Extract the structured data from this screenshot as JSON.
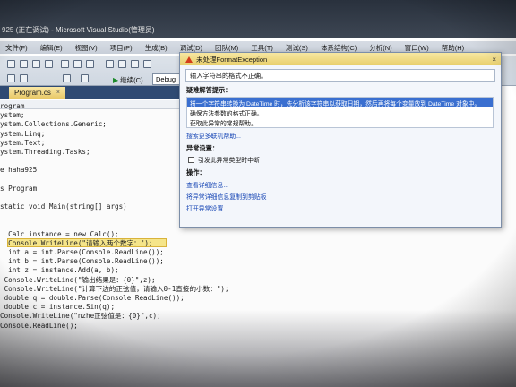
{
  "window": {
    "title": "925 (正在调试) - Microsoft Visual Studio(管理员)"
  },
  "menu": [
    "文件(F)",
    "编辑(E)",
    "视图(V)",
    "项目(P)",
    "生成(B)",
    "调试(D)",
    "团队(M)",
    "工具(T)",
    "测试(S)",
    "体系结构(C)",
    "分析(N)",
    "窗口(W)",
    "帮助(H)"
  ],
  "toolbar": {
    "continue_label": "继续(C)",
    "config_value": "Debug"
  },
  "tab": {
    "label": "Program.cs",
    "close_glyph": "×"
  },
  "code": [
    {
      "t": "rogram"
    },
    {
      "t": "ystem;"
    },
    {
      "t": "ystem.Collections.Generic;"
    },
    {
      "t": "ystem.Linq;"
    },
    {
      "t": "ystem.Text;"
    },
    {
      "t": "ystem.Threading.Tasks;"
    },
    {
      "t": ""
    },
    {
      "t": "e haha925"
    },
    {
      "t": ""
    },
    {
      "t": "s Program"
    },
    {
      "t": ""
    },
    {
      "t": "static void Main(string[] args)"
    },
    {
      "t": ""
    },
    {
      "t": ""
    },
    {
      "t": "  Calc instance = new Calc();"
    },
    {
      "t": "  Console.WriteLine(\"请输入两个数字：\");"
    },
    {
      "t": "  int a = int.Parse(Console.ReadLine());"
    },
    {
      "t": "  int b = int.Parse(Console.ReadLine());"
    },
    {
      "t": "  int z = instance.Add(a, b);"
    },
    {
      "t": " Console.WriteLine(\"输出结果是：{0}\",z);"
    },
    {
      "t": " Console.WriteLine(\"计算下边的正弦值，请输入0-1直接的小数：\");"
    },
    {
      "t": " double q = double.Parse(Console.ReadLine());"
    },
    {
      "t": " double c = instance.Sin(q);"
    },
    {
      "t": "Console.WriteLine(\"nzhe正弦值是：{0}\",c);"
    },
    {
      "t": "Console.ReadLine();"
    }
  ],
  "exception": {
    "title": "未处理FormatException",
    "close_glyph": "×",
    "message": "输入字符串的格式不正确。",
    "tips_heading": "疑难解答提示：",
    "tips": [
      "将一个字符串转换为 DateTime 时，先分析该字符串以获取日期，然后再将每个变量放到 DateTime 对象中。",
      "确保方法参数的格式正确。",
      "获取此异常的常规帮助。"
    ],
    "search_link": "搜索更多联机帮助...",
    "settings_heading": "异常设置：",
    "checkbox_label": "引发此异常类型时中断",
    "actions_heading": "操作：",
    "actions": [
      "查看详细信息...",
      "将异常详细信息复制到剪贴板",
      "打开异常设置"
    ]
  }
}
